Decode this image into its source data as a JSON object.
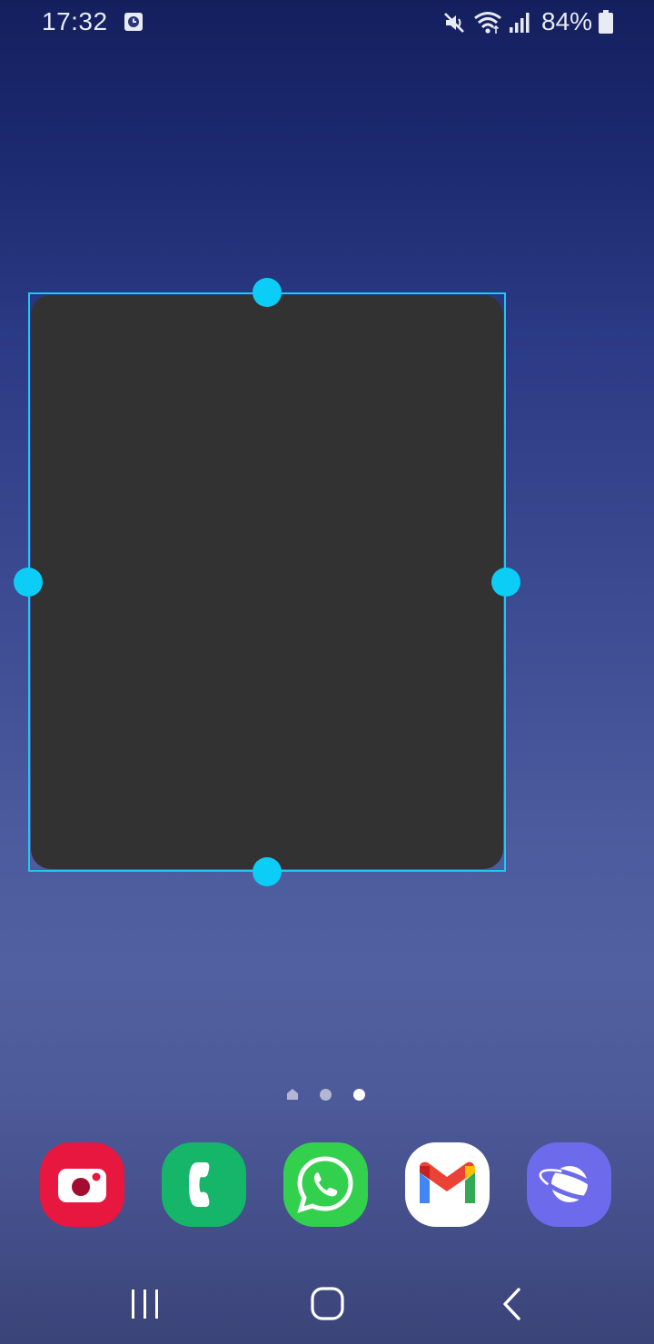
{
  "status_bar": {
    "time": "17:32",
    "battery_percent": "84%",
    "icons": [
      "alarm-icon",
      "mute-icon",
      "wifi-icon",
      "signal-icon",
      "battery-icon"
    ]
  },
  "widget": {
    "state": "resize-mode",
    "frame_color": "#1ec8f3",
    "body_color": "#323232",
    "handles": [
      "top",
      "right",
      "bottom",
      "left"
    ]
  },
  "home_screen": {
    "page_indicators": [
      {
        "type": "home",
        "active": false
      },
      {
        "type": "page",
        "active": false
      },
      {
        "type": "page",
        "active": true
      }
    ],
    "current_page": 3,
    "page_count": 3
  },
  "dock": {
    "apps": [
      {
        "id": "camera",
        "icon": "camera-icon",
        "color": "#e8173f"
      },
      {
        "id": "phone",
        "icon": "phone-icon",
        "color": "#15b56a"
      },
      {
        "id": "whatsapp",
        "icon": "whatsapp-icon",
        "color": "#33d04e"
      },
      {
        "id": "gmail",
        "icon": "gmail-icon",
        "color": "#ffffff"
      },
      {
        "id": "internet",
        "icon": "internet-planet-icon",
        "color": "#6e6aec"
      }
    ]
  },
  "nav_bar": {
    "buttons": [
      "recents-icon",
      "home-icon",
      "back-icon"
    ]
  }
}
